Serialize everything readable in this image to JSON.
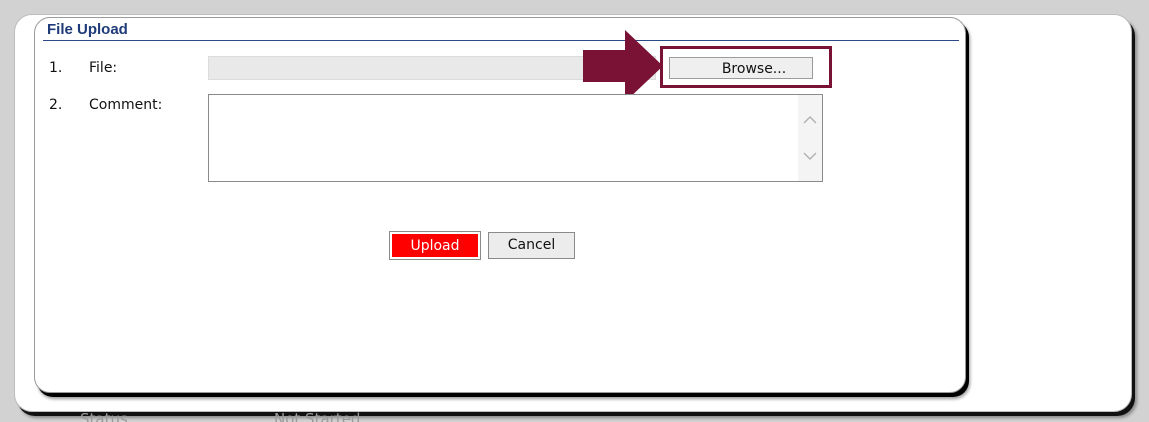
{
  "dialog": {
    "title": "File Upload"
  },
  "form": {
    "rows": [
      {
        "number": "1.",
        "label": "File:"
      },
      {
        "number": "2.",
        "label": "Comment:"
      }
    ],
    "file_value": "",
    "comment_value": "",
    "browse_label": "Browse..."
  },
  "actions": {
    "upload_label": "Upload",
    "cancel_label": "Cancel"
  },
  "background": {
    "status_label": "Status:",
    "status_value": "Not Started"
  },
  "colors": {
    "annotation": "#7a1236",
    "upload_button": "#ff0000",
    "title_text": "#1f3a78"
  },
  "icons": {
    "annotation": "right-arrow-icon",
    "scroll_up": "chevron-up-icon",
    "scroll_down": "chevron-down-icon"
  }
}
